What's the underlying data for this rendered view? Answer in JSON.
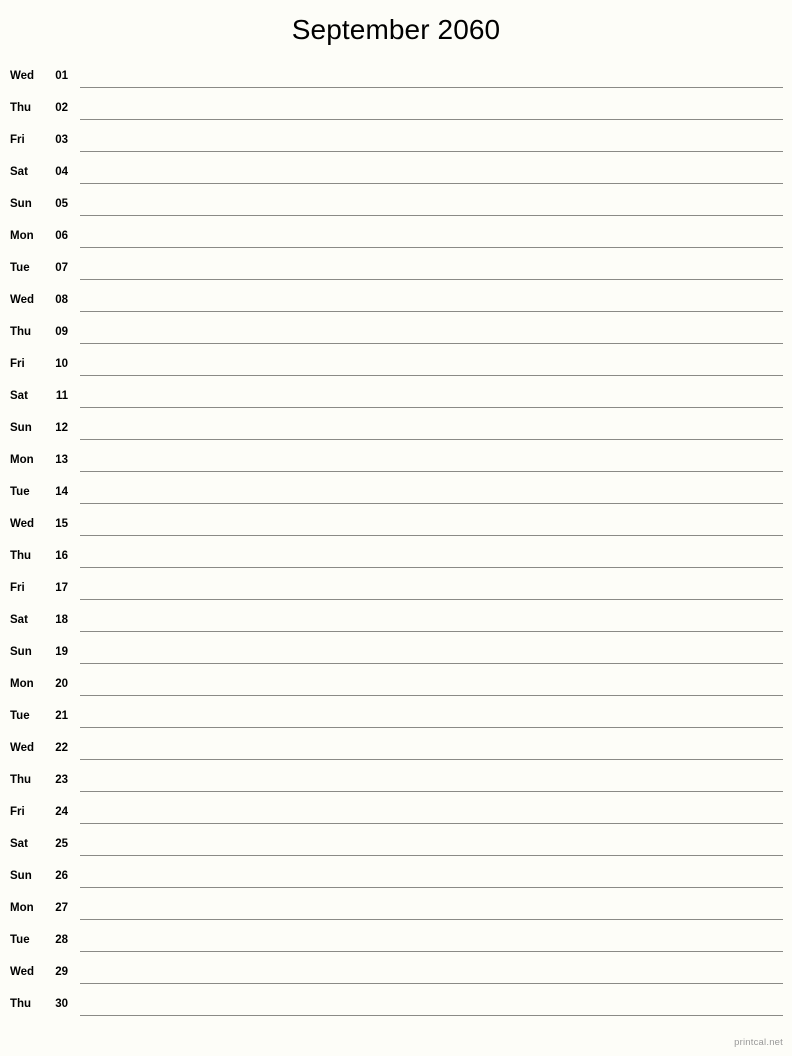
{
  "header": {
    "title": "September 2060"
  },
  "calendar": {
    "month": "September",
    "year": "2060",
    "days": [
      {
        "weekday": "Wed",
        "number": "01"
      },
      {
        "weekday": "Thu",
        "number": "02"
      },
      {
        "weekday": "Fri",
        "number": "03"
      },
      {
        "weekday": "Sat",
        "number": "04"
      },
      {
        "weekday": "Sun",
        "number": "05"
      },
      {
        "weekday": "Mon",
        "number": "06"
      },
      {
        "weekday": "Tue",
        "number": "07"
      },
      {
        "weekday": "Wed",
        "number": "08"
      },
      {
        "weekday": "Thu",
        "number": "09"
      },
      {
        "weekday": "Fri",
        "number": "10"
      },
      {
        "weekday": "Sat",
        "number": "11"
      },
      {
        "weekday": "Sun",
        "number": "12"
      },
      {
        "weekday": "Mon",
        "number": "13"
      },
      {
        "weekday": "Tue",
        "number": "14"
      },
      {
        "weekday": "Wed",
        "number": "15"
      },
      {
        "weekday": "Thu",
        "number": "16"
      },
      {
        "weekday": "Fri",
        "number": "17"
      },
      {
        "weekday": "Sat",
        "number": "18"
      },
      {
        "weekday": "Sun",
        "number": "19"
      },
      {
        "weekday": "Mon",
        "number": "20"
      },
      {
        "weekday": "Tue",
        "number": "21"
      },
      {
        "weekday": "Wed",
        "number": "22"
      },
      {
        "weekday": "Thu",
        "number": "23"
      },
      {
        "weekday": "Fri",
        "number": "24"
      },
      {
        "weekday": "Sat",
        "number": "25"
      },
      {
        "weekday": "Sun",
        "number": "26"
      },
      {
        "weekday": "Mon",
        "number": "27"
      },
      {
        "weekday": "Tue",
        "number": "28"
      },
      {
        "weekday": "Wed",
        "number": "29"
      },
      {
        "weekday": "Thu",
        "number": "30"
      }
    ]
  },
  "footer": {
    "credit": "printcal.net"
  },
  "colors": {
    "background": "#fdfdf8",
    "text": "#000000",
    "rule_line": "#8a8a86",
    "footer_text": "#999999"
  }
}
